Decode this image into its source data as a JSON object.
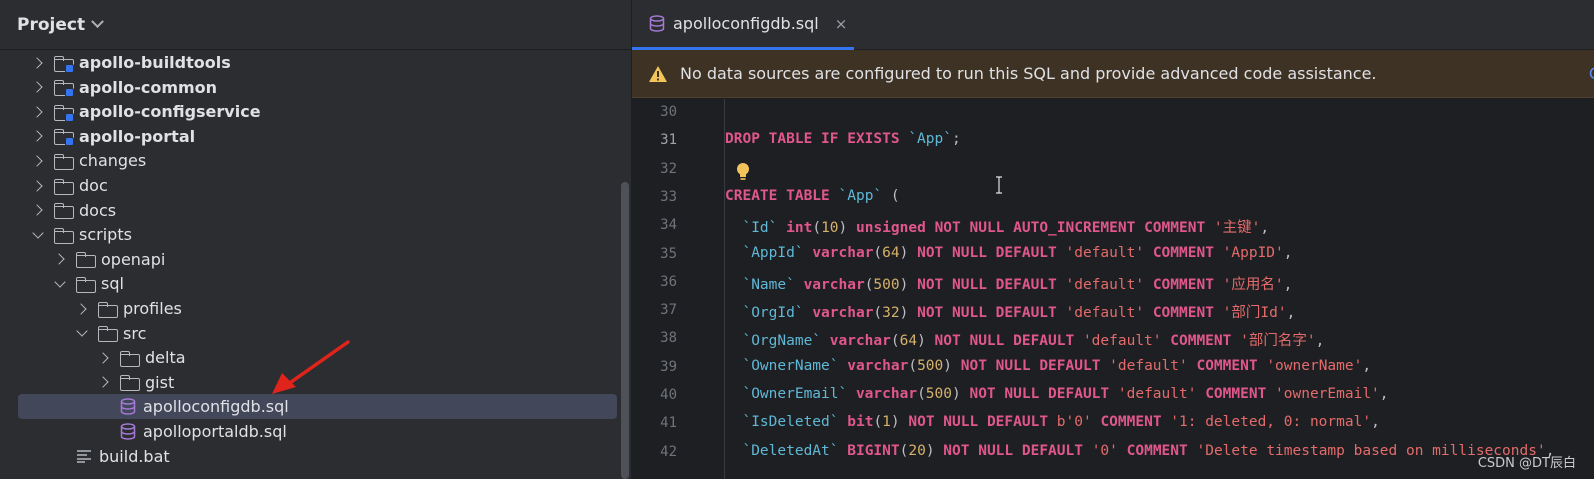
{
  "project_panel": {
    "title": "Project",
    "tree": [
      {
        "label": "apollo-buildtools",
        "type": "module",
        "expanded": false,
        "depth": 0
      },
      {
        "label": "apollo-common",
        "type": "module",
        "expanded": false,
        "depth": 0
      },
      {
        "label": "apollo-configservice",
        "type": "module",
        "expanded": false,
        "depth": 0
      },
      {
        "label": "apollo-portal",
        "type": "module",
        "expanded": false,
        "depth": 0
      },
      {
        "label": "changes",
        "type": "folder",
        "expanded": false,
        "depth": 0
      },
      {
        "label": "doc",
        "type": "folder",
        "expanded": false,
        "depth": 0
      },
      {
        "label": "docs",
        "type": "folder",
        "expanded": false,
        "depth": 0
      },
      {
        "label": "scripts",
        "type": "folder",
        "expanded": true,
        "depth": 0
      },
      {
        "label": "openapi",
        "type": "folder",
        "expanded": false,
        "depth": 1
      },
      {
        "label": "sql",
        "type": "folder",
        "expanded": true,
        "depth": 1
      },
      {
        "label": "profiles",
        "type": "folder",
        "expanded": false,
        "depth": 2
      },
      {
        "label": "src",
        "type": "folder",
        "expanded": true,
        "depth": 2
      },
      {
        "label": "delta",
        "type": "folder",
        "expanded": false,
        "depth": 3
      },
      {
        "label": "gist",
        "type": "folder",
        "expanded": false,
        "depth": 3
      },
      {
        "label": "apolloconfigdb.sql",
        "type": "sql",
        "depth": 3,
        "selected": true
      },
      {
        "label": "apolloportaldb.sql",
        "type": "sql",
        "depth": 3
      },
      {
        "label": "build.bat",
        "type": "text",
        "depth": 1
      }
    ]
  },
  "editor": {
    "tab": {
      "label": "apolloconfigdb.sql",
      "close": "×"
    },
    "banner": {
      "text": "No data sources are configured to run this SQL and provide advanced code assistance.",
      "link": "C"
    },
    "current_line": "31",
    "lines": [
      {
        "no": "30",
        "tokens": []
      },
      {
        "no": "31",
        "tokens": [
          [
            "k",
            "DROP TABLE IF EXISTS "
          ],
          [
            "id",
            "`App`"
          ],
          [
            "p",
            ";"
          ]
        ]
      },
      {
        "no": "32",
        "tokens": []
      },
      {
        "no": "33",
        "tokens": [
          [
            "k",
            "CREATE TABLE "
          ],
          [
            "id",
            "`App`"
          ],
          [
            "p",
            " ("
          ]
        ]
      },
      {
        "no": "34",
        "tokens": [
          [
            "id",
            "  `Id`"
          ],
          [
            "p",
            " "
          ],
          [
            "k",
            "int"
          ],
          [
            "p",
            "("
          ],
          [
            "n",
            "10"
          ],
          [
            "p",
            ") "
          ],
          [
            "k",
            "unsigned NOT NULL AUTO_INCREMENT COMMENT "
          ],
          [
            "s",
            "'主键'"
          ],
          [
            "p",
            ","
          ]
        ]
      },
      {
        "no": "35",
        "tokens": [
          [
            "id",
            "  `AppId`"
          ],
          [
            "p",
            " "
          ],
          [
            "k",
            "varchar"
          ],
          [
            "p",
            "("
          ],
          [
            "n",
            "64"
          ],
          [
            "p",
            ") "
          ],
          [
            "k",
            "NOT NULL DEFAULT "
          ],
          [
            "s",
            "'default'"
          ],
          [
            "p",
            " "
          ],
          [
            "k",
            "COMMENT "
          ],
          [
            "s",
            "'AppID'"
          ],
          [
            "p",
            ","
          ]
        ]
      },
      {
        "no": "36",
        "tokens": [
          [
            "id",
            "  `Name`"
          ],
          [
            "p",
            " "
          ],
          [
            "k",
            "varchar"
          ],
          [
            "p",
            "("
          ],
          [
            "n",
            "500"
          ],
          [
            "p",
            ") "
          ],
          [
            "k",
            "NOT NULL DEFAULT "
          ],
          [
            "s",
            "'default'"
          ],
          [
            "p",
            " "
          ],
          [
            "k",
            "COMMENT "
          ],
          [
            "s",
            "'应用名'"
          ],
          [
            "p",
            ","
          ]
        ]
      },
      {
        "no": "37",
        "tokens": [
          [
            "id",
            "  `OrgId`"
          ],
          [
            "p",
            " "
          ],
          [
            "k",
            "varchar"
          ],
          [
            "p",
            "("
          ],
          [
            "n",
            "32"
          ],
          [
            "p",
            ") "
          ],
          [
            "k",
            "NOT NULL DEFAULT "
          ],
          [
            "s",
            "'default'"
          ],
          [
            "p",
            " "
          ],
          [
            "k",
            "COMMENT "
          ],
          [
            "s",
            "'部门Id'"
          ],
          [
            "p",
            ","
          ]
        ]
      },
      {
        "no": "38",
        "tokens": [
          [
            "id",
            "  `OrgName`"
          ],
          [
            "p",
            " "
          ],
          [
            "k",
            "varchar"
          ],
          [
            "p",
            "("
          ],
          [
            "n",
            "64"
          ],
          [
            "p",
            ") "
          ],
          [
            "k",
            "NOT NULL DEFAULT "
          ],
          [
            "s",
            "'default'"
          ],
          [
            "p",
            " "
          ],
          [
            "k",
            "COMMENT "
          ],
          [
            "s",
            "'部门名字'"
          ],
          [
            "p",
            ","
          ]
        ]
      },
      {
        "no": "39",
        "tokens": [
          [
            "id",
            "  `OwnerName`"
          ],
          [
            "p",
            " "
          ],
          [
            "k",
            "varchar"
          ],
          [
            "p",
            "("
          ],
          [
            "n",
            "500"
          ],
          [
            "p",
            ") "
          ],
          [
            "k",
            "NOT NULL DEFAULT "
          ],
          [
            "s",
            "'default'"
          ],
          [
            "p",
            " "
          ],
          [
            "k",
            "COMMENT "
          ],
          [
            "s",
            "'ownerName'"
          ],
          [
            "p",
            ","
          ]
        ]
      },
      {
        "no": "40",
        "tokens": [
          [
            "id",
            "  `OwnerEmail`"
          ],
          [
            "p",
            " "
          ],
          [
            "k",
            "varchar"
          ],
          [
            "p",
            "("
          ],
          [
            "n",
            "500"
          ],
          [
            "p",
            ") "
          ],
          [
            "k",
            "NOT NULL DEFAULT "
          ],
          [
            "s",
            "'default'"
          ],
          [
            "p",
            " "
          ],
          [
            "k",
            "COMMENT "
          ],
          [
            "s",
            "'ownerEmail'"
          ],
          [
            "p",
            ","
          ]
        ]
      },
      {
        "no": "41",
        "tokens": [
          [
            "id",
            "  `IsDeleted`"
          ],
          [
            "p",
            " "
          ],
          [
            "k",
            "bit"
          ],
          [
            "p",
            "("
          ],
          [
            "n",
            "1"
          ],
          [
            "p",
            ") "
          ],
          [
            "k",
            "NOT NULL DEFAULT "
          ],
          [
            "s",
            "b'0'"
          ],
          [
            "p",
            " "
          ],
          [
            "k",
            "COMMENT "
          ],
          [
            "s",
            "'1: deleted, 0: normal'"
          ],
          [
            "p",
            ","
          ]
        ]
      },
      {
        "no": "42",
        "tokens": [
          [
            "id",
            "  `DeletedAt`"
          ],
          [
            "p",
            " "
          ],
          [
            "k",
            "BIGINT"
          ],
          [
            "p",
            "("
          ],
          [
            "n",
            "20"
          ],
          [
            "p",
            ") "
          ],
          [
            "k",
            "NOT NULL DEFAULT "
          ],
          [
            "s",
            "'0'"
          ],
          [
            "p",
            " "
          ],
          [
            "k",
            "COMMENT "
          ],
          [
            "s",
            "'Delete timestamp based on milliseconds'"
          ],
          [
            "p",
            ","
          ]
        ]
      }
    ]
  },
  "watermark": "CSDN @DT辰白",
  "colors": {
    "accent": "#3574f0",
    "keyword": "#e0578b",
    "identifier": "#5fb8d6",
    "string": "#e36b6b",
    "number": "#d6b16b",
    "warning_bg": "#3d3223"
  }
}
